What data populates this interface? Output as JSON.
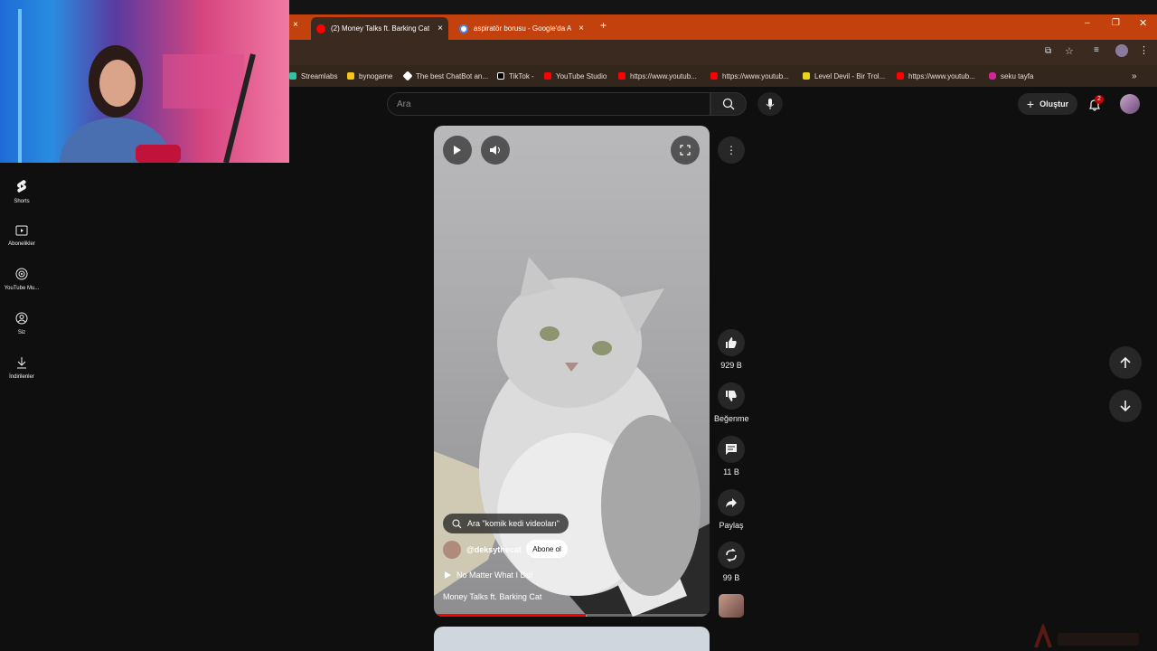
{
  "browser": {
    "tabs": [
      {
        "title": "(2) Money Talks ft. Barking Cat",
        "active": true
      },
      {
        "title": "aspiratör borusu - Google'da A",
        "active": false
      }
    ],
    "new_tab": "+",
    "bookmarks": [
      "Streamlabs",
      "bynogame",
      "The best ChatBot an...",
      "TikTok -",
      "YouTube Studio",
      "https://www.youtub...",
      "https://www.youtub...",
      "Level Devil - Bir Trol...",
      "https://www.youtub...",
      "seku tayfa"
    ],
    "more_bookmarks": "»"
  },
  "sidebar": {
    "items": [
      {
        "label": "Shorts",
        "icon": "shorts-icon"
      },
      {
        "label": "Abonelikler",
        "icon": "subscriptions-icon"
      },
      {
        "label": "YouTube Mu...",
        "icon": "music-icon"
      },
      {
        "label": "Siz",
        "icon": "user-icon"
      },
      {
        "label": "İndirilenler",
        "icon": "download-icon"
      }
    ]
  },
  "header": {
    "search_placeholder": "Ara",
    "create_label": "Oluştur",
    "notification_count": "2"
  },
  "short": {
    "search_chip": "Ara \"komik kedi videoları\"",
    "channel": "@deksythecat",
    "subscribe_label": "Abone ol",
    "music": "No Matter What I Do!",
    "title": "Money Talks ft. Barking Cat",
    "progress": 0.55
  },
  "actions": {
    "likes": "929 B",
    "dislike_label": "Beğenme",
    "comments": "11 B",
    "share_label": "Paylaş",
    "remix_count": "99 B"
  },
  "colors": {
    "accent": "#ff0000",
    "tab_bar": "#c2410c",
    "background": "#0f0f0f"
  }
}
